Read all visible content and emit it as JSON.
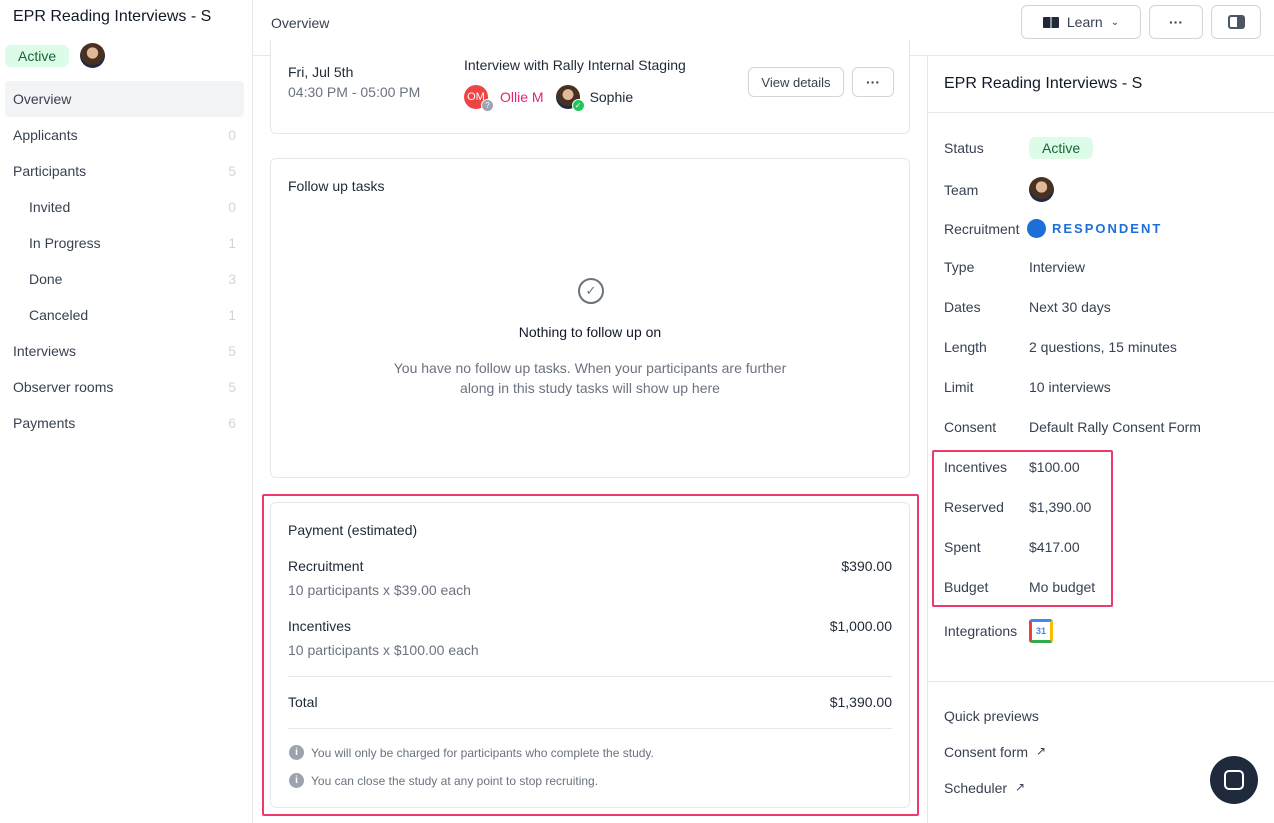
{
  "sidebar": {
    "title": "EPR Reading Interviews - S",
    "status": "Active",
    "items": [
      {
        "label": "Overview",
        "count": ""
      },
      {
        "label": "Applicants",
        "count": "0"
      },
      {
        "label": "Participants",
        "count": "5"
      },
      {
        "label": "Invited",
        "count": "0"
      },
      {
        "label": "In Progress",
        "count": "1"
      },
      {
        "label": "Done",
        "count": "3"
      },
      {
        "label": "Canceled",
        "count": "1"
      },
      {
        "label": "Interviews",
        "count": "5"
      },
      {
        "label": "Observer rooms",
        "count": "5"
      },
      {
        "label": "Payments",
        "count": "6"
      }
    ]
  },
  "header": {
    "title": "Overview",
    "learn": "Learn"
  },
  "interview": {
    "date": "Fri, Jul 5th",
    "time": "04:30 PM - 05:00 PM",
    "title": "Interview with Rally Internal Staging",
    "p1_initials": "OM",
    "p1": "Ollie M",
    "p2": "Sophie",
    "view": "View details"
  },
  "followup": {
    "title": "Follow up tasks",
    "empty_title": "Nothing to follow up on",
    "empty_line1": "You have no follow up tasks. When your participants are further",
    "empty_line2": "along in this study tasks will show up here"
  },
  "payment": {
    "title": "Payment (estimated)",
    "rec_label": "Recruitment",
    "rec_detail": "10 participants x $39.00 each",
    "rec_amount": "$390.00",
    "inc_label": "Incentives",
    "inc_detail": "10 participants x $100.00 each",
    "inc_amount": "$1,000.00",
    "total_label": "Total",
    "total_amount": "$1,390.00",
    "note1": "You will only be charged for participants who complete the study.",
    "note2": "You can close the study at any point to stop recruiting."
  },
  "panel": {
    "title": "EPR Reading Interviews - S",
    "status_label": "Status",
    "status": "Active",
    "team_label": "Team",
    "recruitment_label": "Recruitment",
    "recruitment_logo": "RESPONDENT",
    "rows": [
      {
        "label": "Type",
        "value": "Interview"
      },
      {
        "label": "Dates",
        "value": "Next 30 days"
      },
      {
        "label": "Length",
        "value": "2 questions, 15 minutes"
      },
      {
        "label": "Limit",
        "value": "10 interviews"
      },
      {
        "label": "Consent",
        "value": "Default Rally Consent Form"
      },
      {
        "label": "Incentives",
        "value": "$100.00"
      },
      {
        "label": "Reserved",
        "value": "$1,390.00"
      },
      {
        "label": "Spent",
        "value": "$417.00"
      },
      {
        "label": "Budget",
        "value": "Mo budget"
      }
    ],
    "integrations_label": "Integrations",
    "calendar_day": "31",
    "quick_title": "Quick previews",
    "consent_link": "Consent form",
    "scheduler_link": "Scheduler"
  },
  "colors": {
    "highlight": "#f0396b",
    "active_bg": "#dcfce7",
    "pink": "#db2777"
  }
}
